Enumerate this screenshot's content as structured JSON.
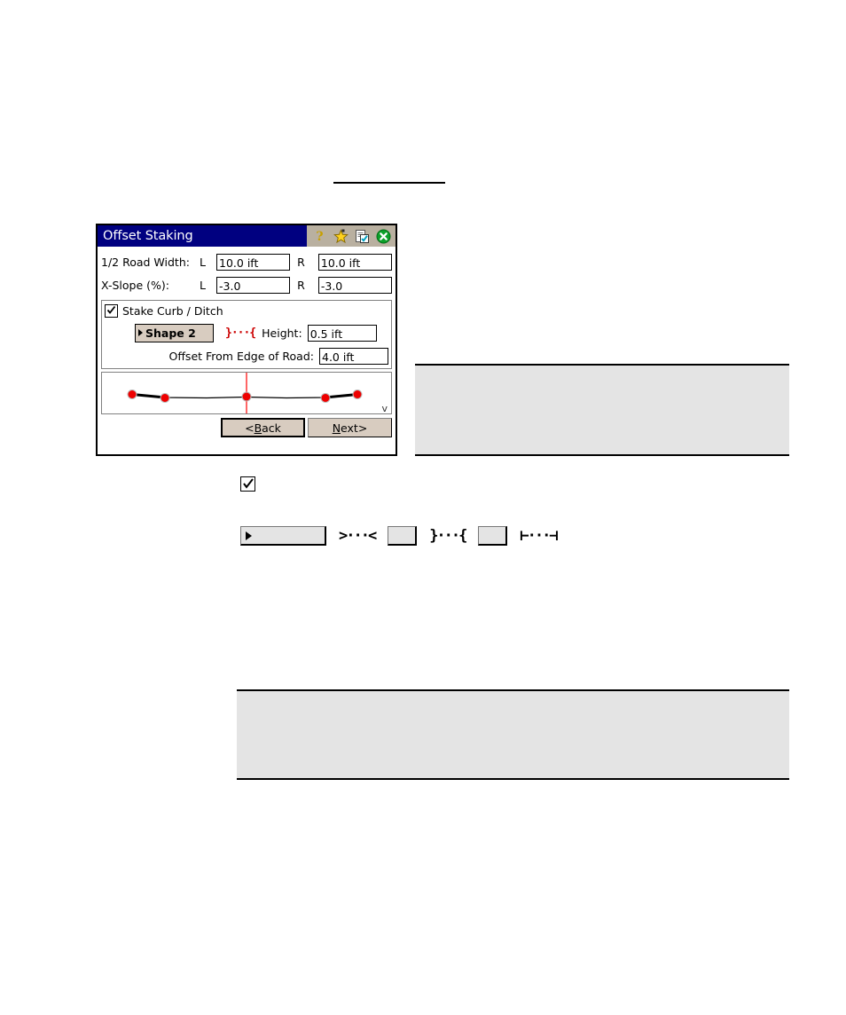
{
  "page": {
    "background": "#ffffff",
    "top_rule": true
  },
  "dialog": {
    "title": "Offset Staking",
    "titlebar": {
      "bg": "#000080",
      "text_color": "#ffffff",
      "icons": [
        {
          "name": "help-icon",
          "glyph": "?"
        },
        {
          "name": "favorites-star-icon",
          "glyph": "star"
        },
        {
          "name": "checklist-document-icon",
          "glyph": "document"
        },
        {
          "name": "close-icon",
          "glyph": "x",
          "color": "#00a000"
        }
      ]
    },
    "fields": {
      "road_width": {
        "label": "1/2 Road Width:",
        "left_letter": "L",
        "left_value": "10.0 ift",
        "right_letter": "R",
        "right_value": "10.0 ift"
      },
      "x_slope": {
        "label": "X-Slope (%):",
        "left_letter": "L",
        "left_value": "-3.0",
        "right_letter": "R",
        "right_value": "-3.0"
      }
    },
    "group": {
      "checkbox_label": "Stake Curb / Ditch",
      "checkbox_checked": true,
      "shape_button": "Shape 2",
      "shape_icon": "}···{",
      "shape_icon_color": "#cc0000",
      "height_label": "Height:",
      "height_value": "0.5 ift",
      "offset_label": "Offset From Edge of Road:",
      "offset_value": "4.0 ift"
    },
    "preview": {
      "corner_mark": "v",
      "centerline_color": "#ff3b30",
      "node_color": "#ee0000",
      "line_color": "#000000"
    },
    "nav": {
      "back_prefix": "< ",
      "back_accel": "B",
      "back_rest": "ack",
      "next_accel": "N",
      "next_rest": "ext",
      "next_suffix": " >"
    }
  },
  "callouts": {
    "top": {
      "text": "",
      "bg": "#e4e4e4"
    },
    "bottom": {
      "text": "",
      "bg": "#e4e4e4"
    }
  },
  "legend": {
    "standalone_checkbox_checked": true,
    "items": [
      {
        "button_label": "",
        "glyph": ">···<",
        "icon_name": "ditch-shape-icon"
      },
      {
        "button_label": "",
        "glyph": "}···{",
        "icon_name": "curb-shape-icon"
      },
      {
        "button_label": "",
        "glyph": "⊢···⊣",
        "icon_name": "flat-shape-icon"
      }
    ]
  }
}
